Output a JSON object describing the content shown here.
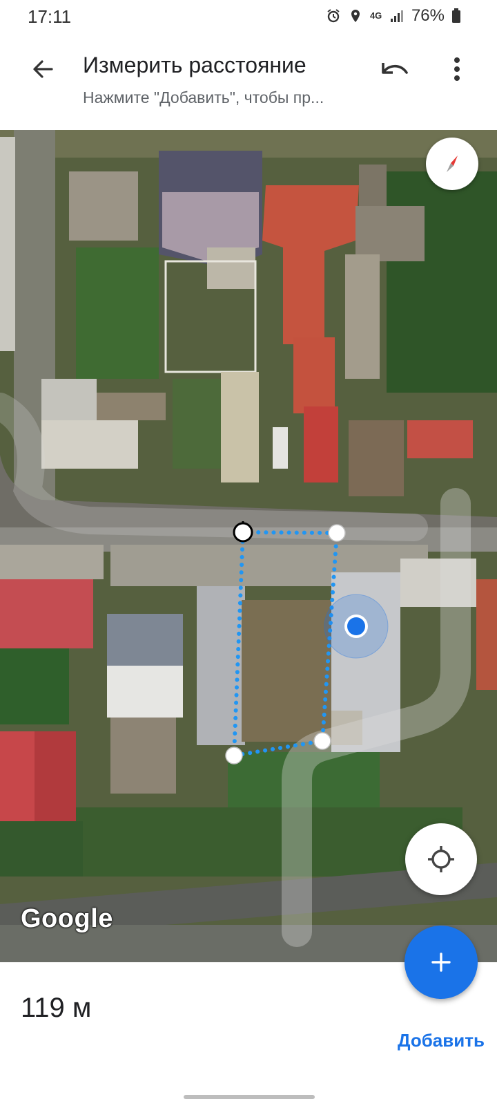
{
  "status_bar": {
    "time": "17:11",
    "network": "4G",
    "battery": "76%",
    "icons": [
      "alarm-icon",
      "location-icon",
      "network-4g-icon",
      "signal-icon",
      "battery-icon"
    ]
  },
  "app_bar": {
    "title": "Измерить расстояние",
    "subtitle": "Нажмите \"Добавить\", чтобы пр...",
    "back_icon": "arrow-back-icon",
    "undo_icon": "undo-icon",
    "more_icon": "more-vert-icon"
  },
  "map": {
    "type": "satellite",
    "logo": "Google",
    "compass_icon": "compass-icon",
    "locate_icon": "my-location-icon",
    "measure_line_color": "#2196f3",
    "user_location_color": "#1a73e8"
  },
  "bottom": {
    "distance": "119 м",
    "add_label": "Добавить",
    "fab_icon": "plus-icon",
    "accent_color": "#1a73e8"
  }
}
